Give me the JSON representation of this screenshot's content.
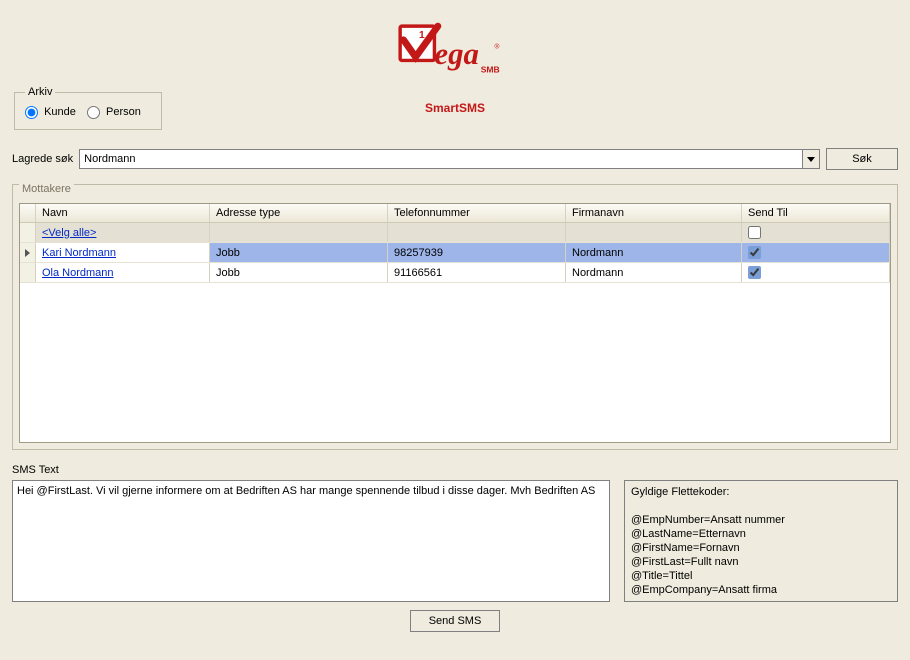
{
  "brand": {
    "subtitle": "SmartSMS"
  },
  "arkiv": {
    "legend": "Arkiv",
    "opt_kunde": "Kunde",
    "opt_person": "Person"
  },
  "search": {
    "label": "Lagrede søk",
    "value": "Nordmann",
    "btn": "Søk"
  },
  "recipients": {
    "group_title": "Mottakere",
    "headers": {
      "navn": "Navn",
      "adresse": "Adresse type",
      "telefon": "Telefonnummer",
      "firma": "Firmanavn",
      "send": "Send Til"
    },
    "select_all": "<Velg alle>",
    "rows": [
      {
        "navn": "Kari Nordmann",
        "adresse": "Jobb",
        "telefon": "98257939",
        "firma": "Nordmann",
        "send": true,
        "selected": true
      },
      {
        "navn": "Ola Nordmann",
        "adresse": "Jobb",
        "telefon": "91166561",
        "firma": "Nordmann",
        "send": true,
        "selected": false
      }
    ]
  },
  "sms": {
    "label": "SMS Text",
    "body": "Hei @FirstLast. Vi vil gjerne informere om at Bedriften AS har mange spennende tilbud i disse dager. Mvh Bedriften AS"
  },
  "codes": {
    "title": "Gyldige Flettekoder:",
    "lines": "@EmpNumber=Ansatt nummer\n@LastName=Etternavn\n@FirstName=Fornavn\n@FirstLast=Fullt navn\n@Title=Tittel\n@EmpCompany=Ansatt firma"
  },
  "send_button": "Send SMS"
}
